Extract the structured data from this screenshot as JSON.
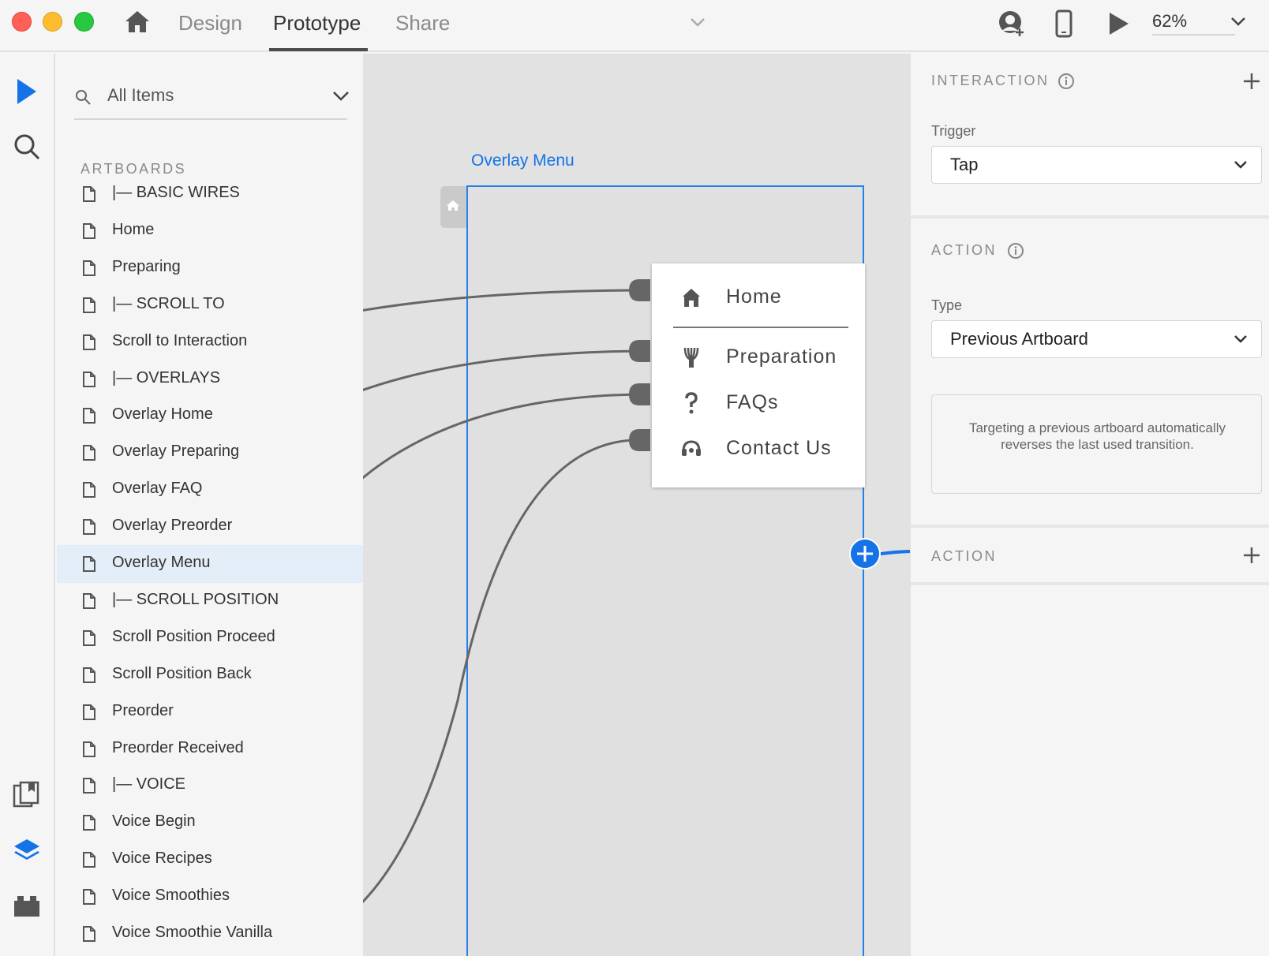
{
  "titlebar": {
    "tabs": [
      {
        "label": "Design"
      },
      {
        "label": "Prototype"
      },
      {
        "label": "Share"
      }
    ],
    "zoom": "62%"
  },
  "layers": {
    "search_label": "All Items",
    "section_label": "ARTBOARDS",
    "items": [
      {
        "label": "|— BASIC WIRES"
      },
      {
        "label": "Home"
      },
      {
        "label": "Preparing"
      },
      {
        "label": "|— SCROLL TO"
      },
      {
        "label": "Scroll to Interaction"
      },
      {
        "label": "|— OVERLAYS"
      },
      {
        "label": "Overlay Home"
      },
      {
        "label": "Overlay Preparing"
      },
      {
        "label": "Overlay FAQ"
      },
      {
        "label": "Overlay Preorder"
      },
      {
        "label": "Overlay Menu",
        "selected": true
      },
      {
        "label": "|— SCROLL POSITION"
      },
      {
        "label": "Scroll Position Proceed"
      },
      {
        "label": "Scroll Position Back"
      },
      {
        "label": "Preorder"
      },
      {
        "label": "Preorder Received"
      },
      {
        "label": "|— VOICE"
      },
      {
        "label": "Voice Begin"
      },
      {
        "label": "Voice Recipes"
      },
      {
        "label": "Voice Smoothies"
      },
      {
        "label": "Voice Smoothie Vanilla"
      }
    ]
  },
  "canvas": {
    "artboard_title": "Overlay Menu",
    "menu": [
      {
        "label": "Home",
        "icon": "home-icon"
      },
      {
        "label": "Preparation",
        "icon": "whisk-icon"
      },
      {
        "label": "FAQs",
        "icon": "question-mark-icon"
      },
      {
        "label": "Contact Us",
        "icon": "headset-icon"
      }
    ],
    "colors": {
      "accent": "#1473e6",
      "wire": "#666666"
    }
  },
  "properties": {
    "interaction_title": "INTERACTION",
    "trigger_label": "Trigger",
    "trigger_value": "Tap",
    "action_title": "ACTION",
    "type_label": "Type",
    "type_value": "Previous Artboard",
    "note": "Targeting a previous artboard automatically reverses the last used transition.",
    "action2_title": "ACTION"
  }
}
